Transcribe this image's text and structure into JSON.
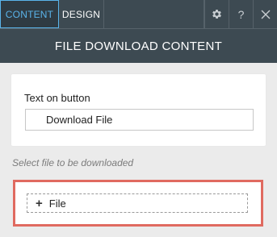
{
  "tabs": {
    "content_label": "CONTENT",
    "design_label": "DESIGN"
  },
  "toolbar": {
    "settings_icon": "gear-icon",
    "help_label": "?",
    "close_icon": "close-icon"
  },
  "header": {
    "title": "FILE DOWNLOAD CONTENT"
  },
  "button_settings": {
    "label": "Text on button",
    "value": "Download File"
  },
  "file_section": {
    "hint": "Select file to be downloaded",
    "add_file_label": "File"
  },
  "colors": {
    "accent": "#5ab4ea",
    "highlight": "#e06a60",
    "header_bg": "#3d4a52"
  }
}
